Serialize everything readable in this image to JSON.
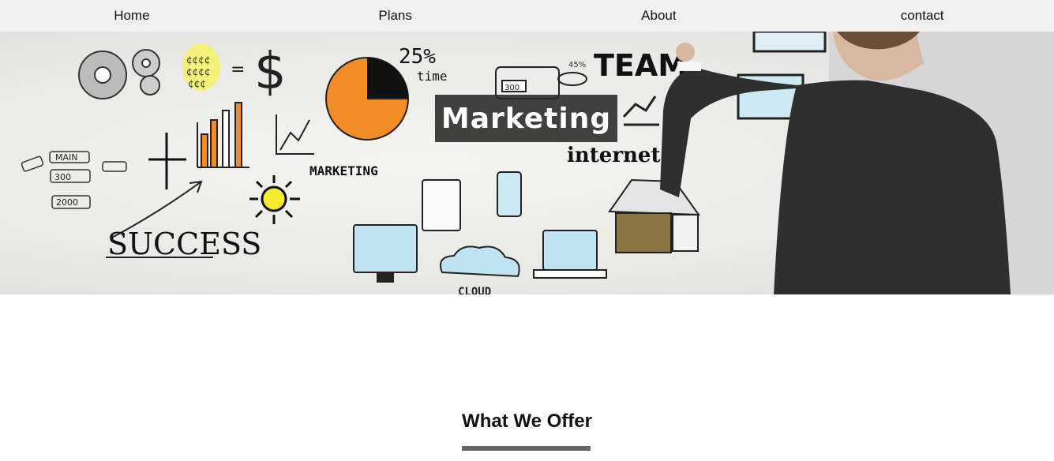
{
  "nav": {
    "items": [
      {
        "label": "Home"
      },
      {
        "label": "Plans"
      },
      {
        "label": "About"
      },
      {
        "label": "contact"
      }
    ]
  },
  "hero": {
    "title": "Marketing",
    "sketch_labels": {
      "percent": "25%",
      "time": "time",
      "team": "TEAM",
      "internet": "internet",
      "marketing": "MARKETING",
      "success": "SUCCESS",
      "main": "MAIN",
      "cloud": "CLOUD",
      "main_300": "300",
      "main_2000": "2000",
      "fortyfive": "45%"
    }
  },
  "offer": {
    "title": "What We Offer"
  },
  "colors": {
    "nav_bg": "#f0f0f0",
    "title_box": "#282828",
    "underline": "#666666",
    "pie_orange": "#f28c28",
    "suit": "#2f2f2f"
  }
}
